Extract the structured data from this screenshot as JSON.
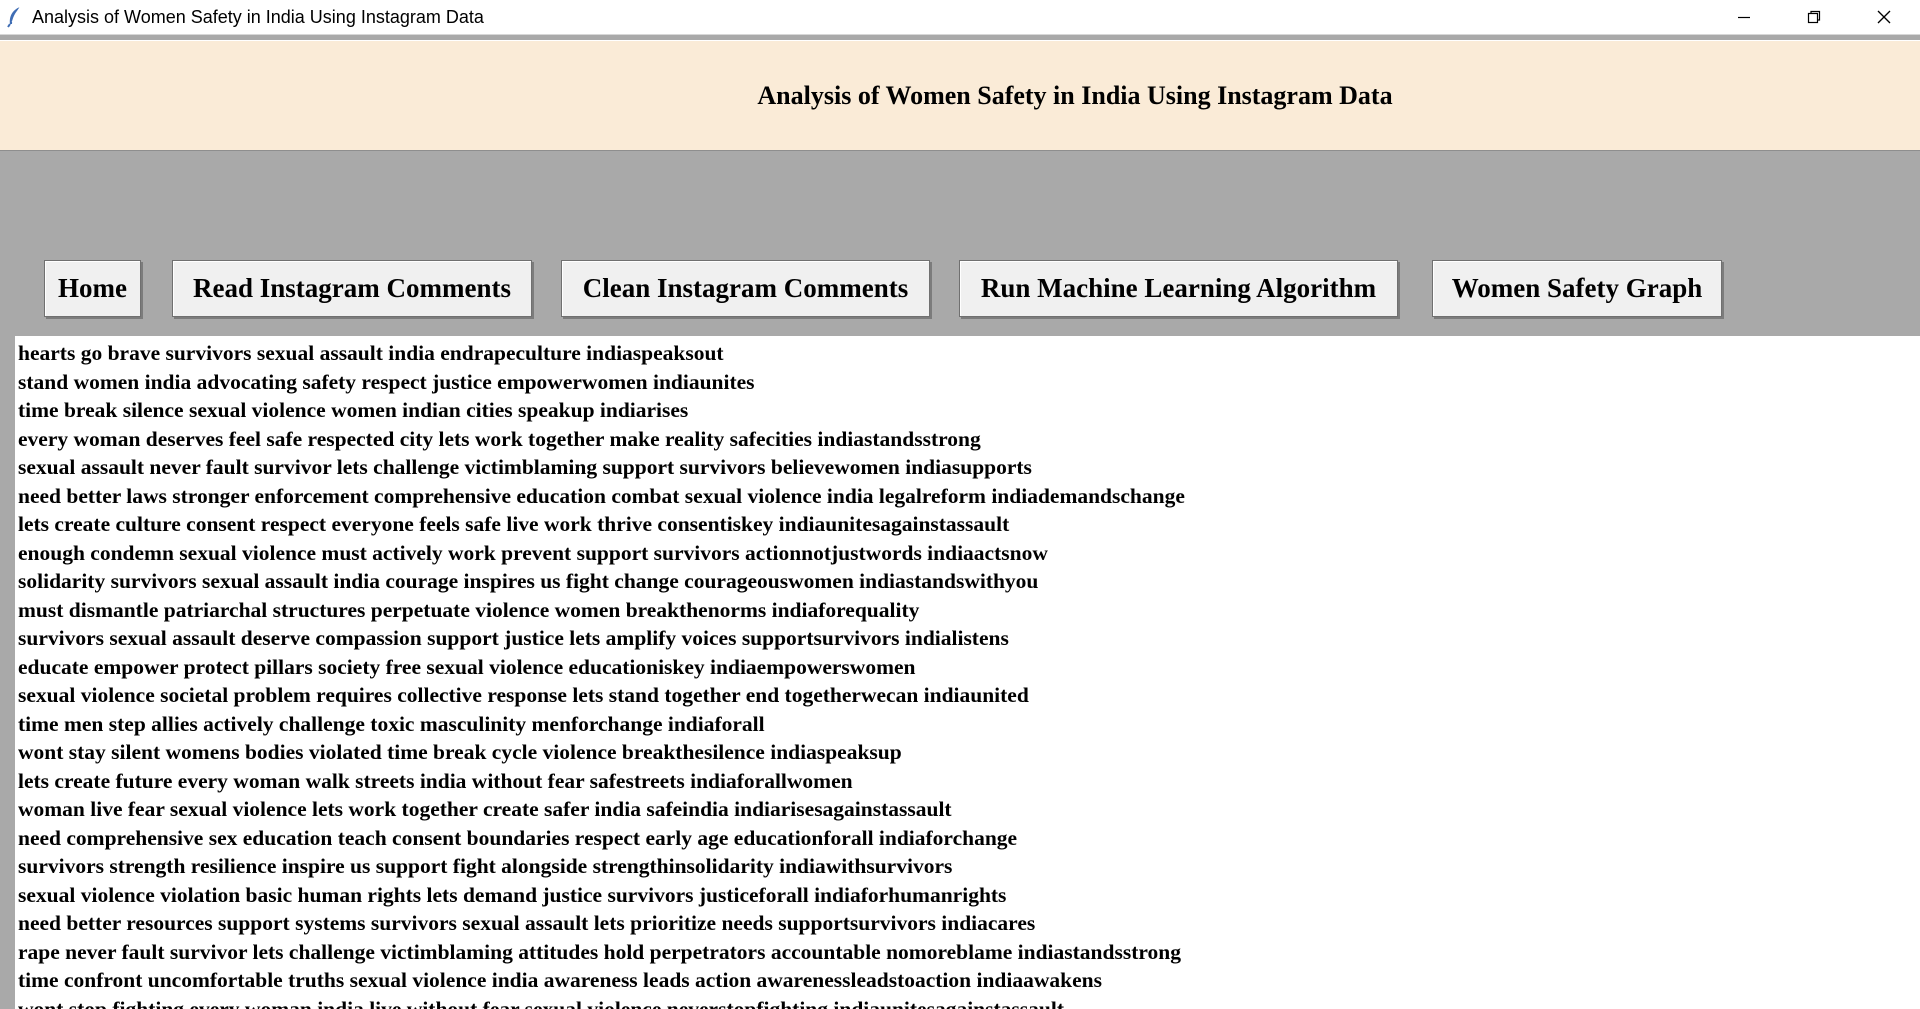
{
  "window": {
    "title": "Analysis of Women Safety in India Using Instagram Data",
    "icon": "feather-icon"
  },
  "header": {
    "heading": "Analysis of Women Safety in India Using Instagram Data",
    "background": "#faebd7"
  },
  "buttons": {
    "home": "Home",
    "read": "Read Instagram Comments",
    "clean": "Clean Instagram Comments",
    "run": "Run Machine Learning Algorithm",
    "graph": "Women Safety Graph"
  },
  "comments": [
    "hearts go brave survivors sexual assault india endrapeculture indiaspeaksout",
    "stand women india advocating safety respect justice empowerwomen indiaunites",
    "time break silence sexual violence women indian cities speakup indiarises",
    "every woman deserves feel safe respected city lets work together make reality safecities indiastandsstrong",
    "sexual assault never fault survivor lets challenge victimblaming support survivors believewomen indiasupports",
    "need better laws stronger enforcement comprehensive education combat sexual violence india legalreform indiademandschange",
    "lets create culture consent respect everyone feels safe live work thrive consentiskey indiaunitesagainstassault",
    "enough condemn sexual violence must actively work prevent support survivors actionnotjustwords indiaactsnow",
    "solidarity survivors sexual assault india courage inspires us fight change courageouswomen indiastandswithyou",
    "must dismantle patriarchal structures perpetuate violence women breakthenorms indiaforequality",
    "survivors sexual assault deserve compassion support justice lets amplify voices supportsurvivors indialistens",
    "educate empower protect pillars society free sexual violence educationiskey indiaempowerswomen",
    "sexual violence societal problem requires collective response lets stand together end togetherwecan indiaunited",
    "time men step allies actively challenge toxic masculinity menforchange indiaforall",
    "wont stay silent womens bodies violated time break cycle violence breakthesilence indiaspeaksup",
    "lets create future every woman walk streets india without fear safestreets indiaforallwomen",
    "woman live fear sexual violence lets work together create safer india safeindia indiarisesagainstassault",
    "need comprehensive sex education teach consent boundaries respect early age educationforall indiaforchange",
    "survivors strength resilience inspire us support fight alongside strengthinsolidarity indiawithsurvivors",
    "sexual violence violation basic human rights lets demand justice survivors justiceforall indiaforhumanrights",
    "need better resources support systems survivors sexual assault lets prioritize needs supportsurvivors indiacares",
    "rape never fault survivor lets challenge victimblaming attitudes hold perpetrators accountable nomoreblame indiastandsstrong",
    "time confront uncomfortable truths sexual violence india awareness leads action awarenessleadstoaction indiaawakens",
    "wont stop fighting every woman india live without fear sexual violence neverstopfighting indiaunitesagainstassault"
  ]
}
